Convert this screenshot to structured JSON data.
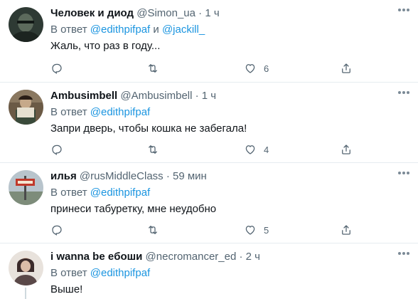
{
  "tweets": [
    {
      "name": "Человек и диод",
      "handle": "@Simon_ua",
      "time": "1 ч",
      "reply_prefix": "В ответ",
      "mentions": [
        "@edithpifpaf",
        "@jackill_"
      ],
      "mention_join": "и",
      "text": "Жаль, что раз в году...",
      "likes": "6"
    },
    {
      "name": "Ambusimbell",
      "handle": "@Ambusimbell",
      "time": "1 ч",
      "reply_prefix": "В ответ",
      "mentions": [
        "@edithpifpaf"
      ],
      "text": "Запри дверь, чтобы кошка не забегала!",
      "likes": "4"
    },
    {
      "name": "илья",
      "handle": "@rusMiddleClass",
      "time": "59 мин",
      "reply_prefix": "В ответ",
      "mentions": [
        "@edithpifpaf"
      ],
      "text": "принеси табуретку, мне неудобно",
      "likes": "5"
    },
    {
      "name": "i wanna be eбоши",
      "handle": "@necromancer_ed",
      "time": "2 ч",
      "reply_prefix": "В ответ",
      "mentions": [
        "@edithpifpaf"
      ],
      "text": "Выше!"
    }
  ],
  "separator": "·",
  "icons": {
    "reply": "reply-icon",
    "retweet": "retweet-icon",
    "like": "heart-icon",
    "share": "share-icon",
    "more": "more-icon"
  },
  "colors": {
    "mention": "#1b95e0",
    "secondary_text": "#536471",
    "divider": "#e6ecf0"
  }
}
